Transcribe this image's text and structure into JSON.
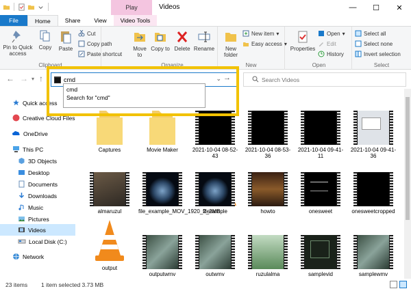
{
  "window": {
    "title": "Videos",
    "context_tab_header": "Play",
    "controls": [
      "—",
      "☐",
      "✕"
    ]
  },
  "tabs": [
    {
      "label": "File"
    },
    {
      "label": "Home"
    },
    {
      "label": "Share"
    },
    {
      "label": "View"
    },
    {
      "label": "Video Tools"
    }
  ],
  "ribbon": {
    "clipboard": {
      "label": "Clipboard",
      "pin": "Pin to Quick access",
      "copy": "Copy",
      "paste": "Paste",
      "cut": "Cut",
      "copy_path": "Copy path",
      "paste_shortcut": "Paste shortcut"
    },
    "organize": {
      "label": "Organize",
      "move_to": "Move to",
      "copy_to": "Copy to",
      "delete": "Delete",
      "rename": "Rename"
    },
    "new": {
      "label": "New",
      "new_folder": "New folder",
      "new_item": "New item",
      "easy_access": "Easy access"
    },
    "open": {
      "label": "Open",
      "properties": "Properties",
      "open": "Open",
      "edit": "Edit",
      "history": "History"
    },
    "select": {
      "label": "Select",
      "select_all": "Select all",
      "select_none": "Select none",
      "invert_selection": "Invert selection"
    }
  },
  "address": {
    "value": "cmd",
    "search_placeholder": "Search Videos"
  },
  "autocomplete": {
    "items": [
      "cmd",
      "Search for \"cmd\""
    ]
  },
  "nav": {
    "items": [
      {
        "label": "Quick access"
      },
      {
        "label": "Creative Cloud Files"
      },
      {
        "label": "OneDrive"
      },
      {
        "label": "This PC"
      },
      {
        "label": "3D Objects"
      },
      {
        "label": "Desktop"
      },
      {
        "label": "Documents"
      },
      {
        "label": "Downloads"
      },
      {
        "label": "Music"
      },
      {
        "label": "Pictures"
      },
      {
        "label": "Videos"
      },
      {
        "label": "Local Disk (C:)"
      },
      {
        "label": "Network"
      }
    ]
  },
  "files": [
    {
      "name": "Captures",
      "kind": "folder"
    },
    {
      "name": "Movie Maker",
      "kind": "folder"
    },
    {
      "name": "2021-10-04 08-52-43",
      "kind": "video"
    },
    {
      "name": "2021-10-04 08-53-36",
      "kind": "video"
    },
    {
      "name": "2021-10-04 09-41-11",
      "kind": "video"
    },
    {
      "name": "2021-10-04 09-41-36",
      "kind": "video"
    },
    {
      "name": "almaruzul",
      "kind": "video"
    },
    {
      "name": "file_example_MOV_1920_2_2MB",
      "kind": "video"
    },
    {
      "name": "filesample",
      "kind": "video"
    },
    {
      "name": "howto",
      "kind": "video"
    },
    {
      "name": "onesweet",
      "kind": "video"
    },
    {
      "name": "onesweetcropped",
      "kind": "video"
    },
    {
      "name": "output",
      "kind": "vlc"
    },
    {
      "name": "outputwmv",
      "kind": "video"
    },
    {
      "name": "outwmv",
      "kind": "video"
    },
    {
      "name": "ruzulalma",
      "kind": "video"
    },
    {
      "name": "samplevid",
      "kind": "video"
    },
    {
      "name": "samplewmv",
      "kind": "video"
    }
  ],
  "status": {
    "items_count": "23 items",
    "selected": "1 item selected  3.73 MB"
  }
}
